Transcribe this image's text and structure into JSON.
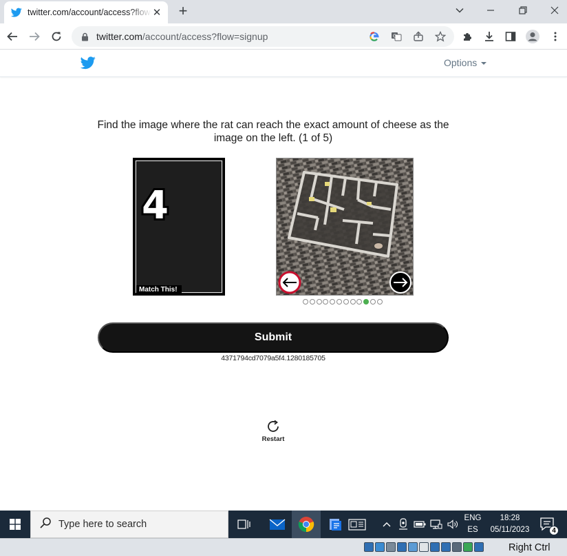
{
  "browser": {
    "tab_title": "twitter.com/account/access?flow=signup",
    "url_host": "twitter.com",
    "url_path": "/account/access?flow=signup"
  },
  "header": {
    "options_label": "Options"
  },
  "captcha": {
    "prompt": "Find the image where the rat can reach the exact amount of cheese as the image on the left. (1 of 5)",
    "match_digit": "4",
    "match_label": "Match This!",
    "dots_total": 12,
    "dots_active_index": 9,
    "submit_label": "Submit",
    "session_id": "4371794cd7079a5f4.1280185705",
    "restart_label": "Restart"
  },
  "taskbar": {
    "search_placeholder": "Type here to search",
    "lang_line1": "ENG",
    "lang_line2": "ES",
    "time": "18:28",
    "date": "05/11/2023",
    "notification_count": "4"
  },
  "vm_bar": {
    "host_key": "Right Ctrl"
  },
  "colors": {
    "twitter_blue": "#1d9bf0",
    "submit_bg": "#141414",
    "active_dot": "#4caf50",
    "taskbar_bg": "#1b2a3a"
  }
}
